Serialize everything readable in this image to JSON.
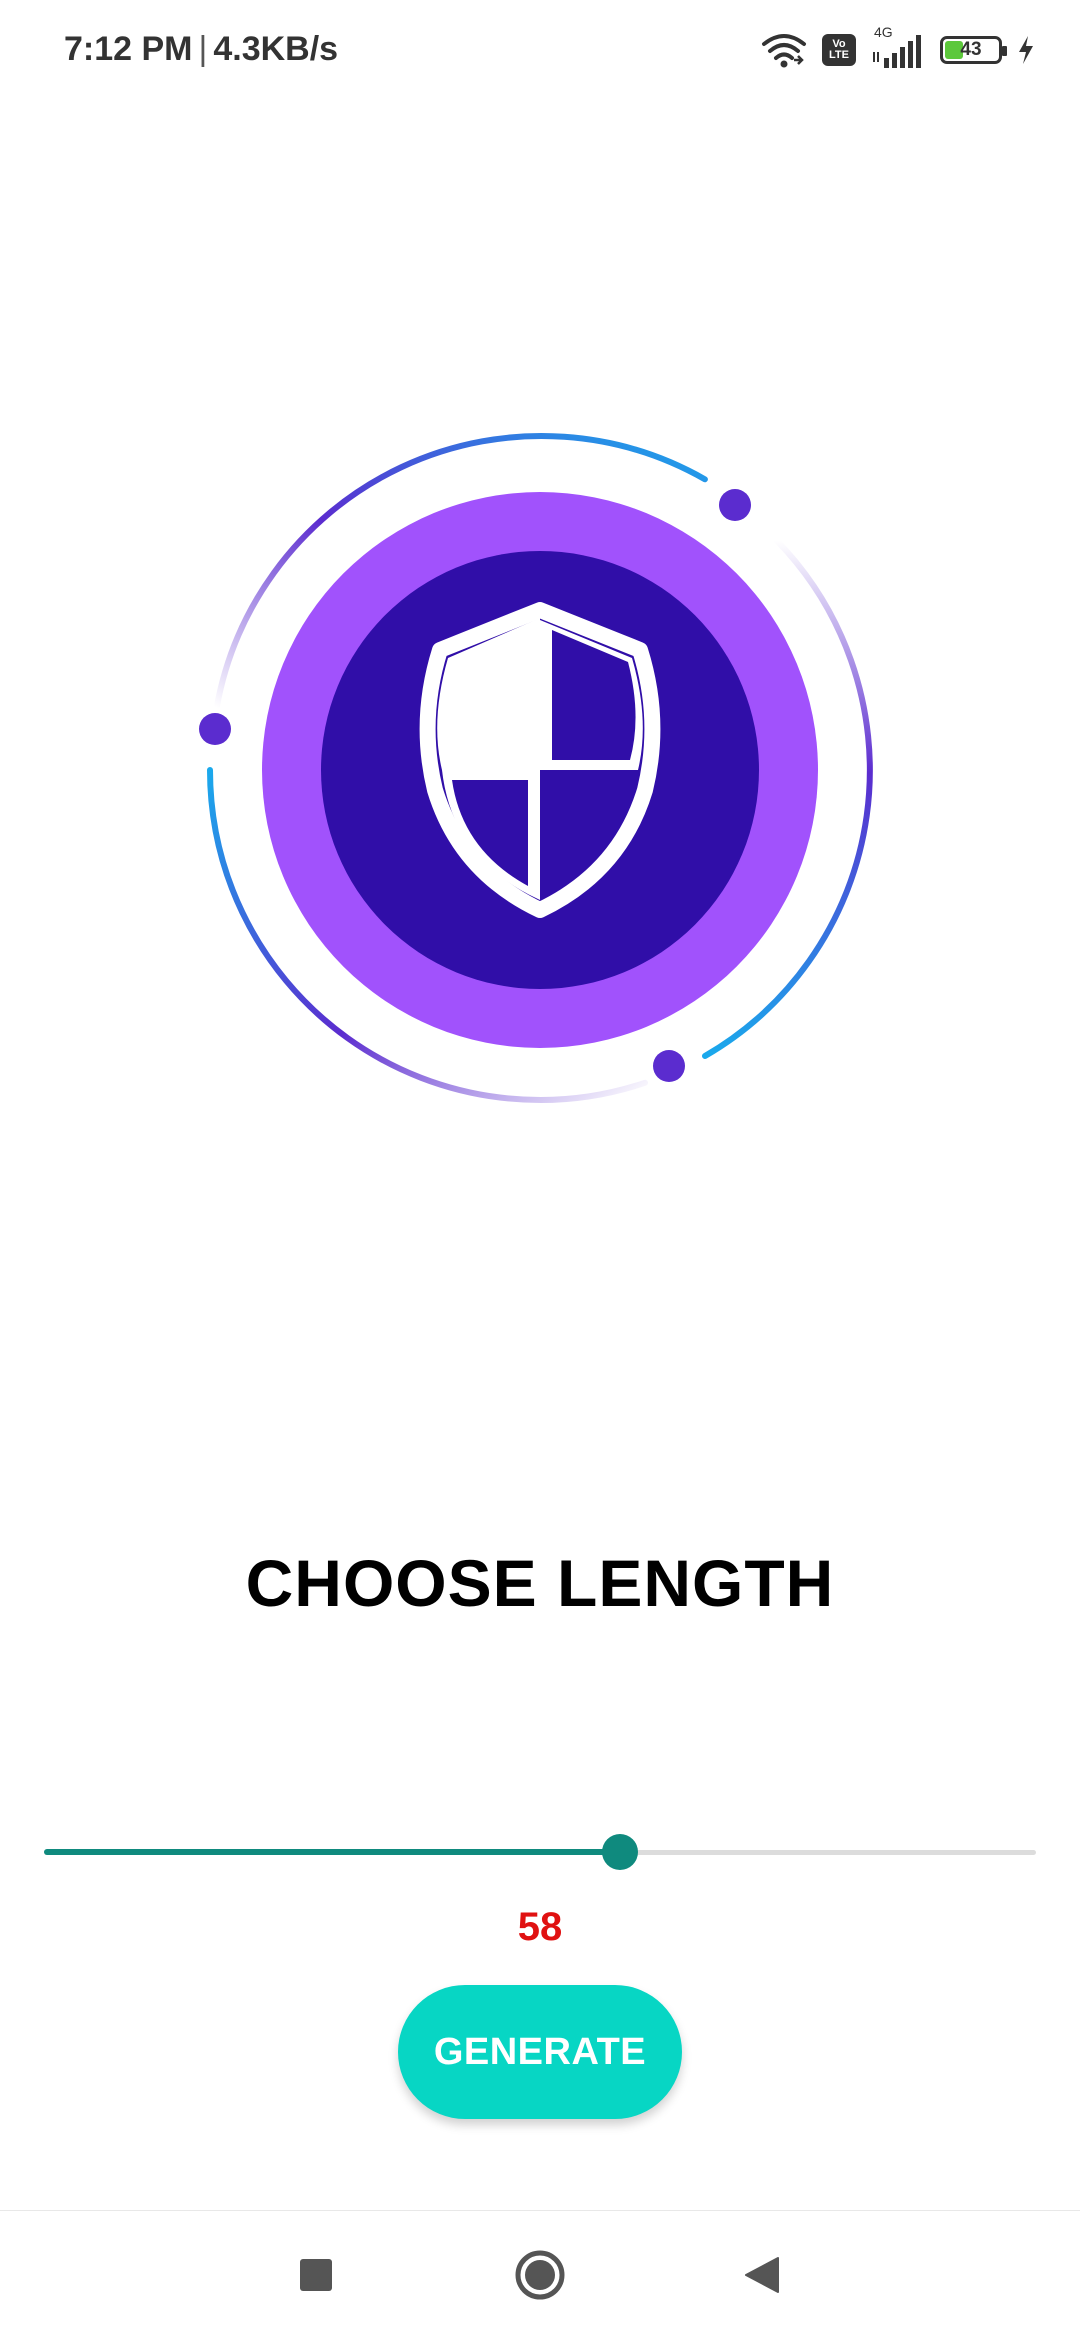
{
  "status_bar": {
    "time": "7:12 PM",
    "separator": "|",
    "net_speed": "4.3KB/s",
    "volte_top": "Vo",
    "volte_bottom": "LTE",
    "network": "4G",
    "battery": "43",
    "icons": [
      "wifi-icon",
      "volte-icon",
      "signal-icon",
      "battery-icon",
      "charging-icon"
    ]
  },
  "hero": {
    "icon": "shield-icon",
    "colors": {
      "outer_disc": "#a152fc",
      "inner_disc": "#300ea8",
      "orbit_blue": "#1aa9ec",
      "orbit_purple": "#5b2ccf",
      "orbit_dot": "#5b2ccf"
    }
  },
  "main": {
    "title": "CHOOSE LENGTH",
    "slider": {
      "fraction": 0.581,
      "active_color": "#0f8a7e",
      "track_color": "#dcdcdc"
    },
    "value": "58",
    "generate_label": "GENERATE"
  },
  "navbar": {
    "icons": [
      "recents-icon",
      "home-icon",
      "back-icon"
    ]
  }
}
